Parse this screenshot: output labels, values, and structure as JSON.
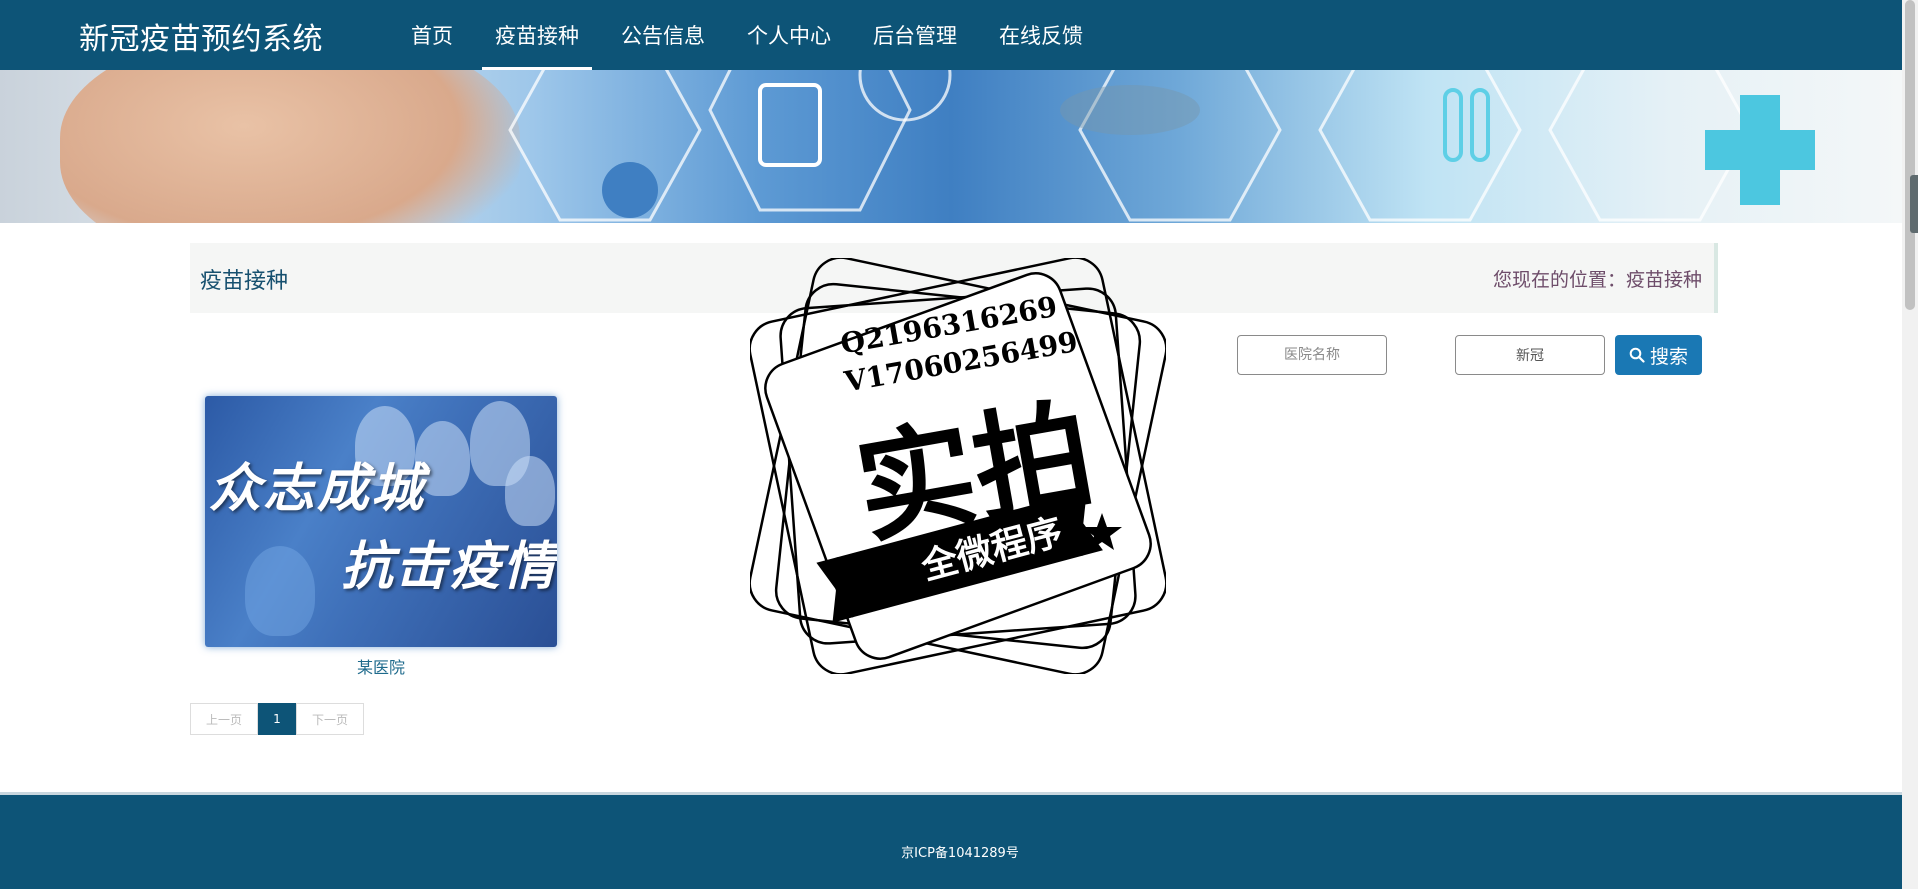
{
  "header": {
    "brand": "新冠疫苗预约系统",
    "nav": [
      {
        "label": "首页",
        "active": false
      },
      {
        "label": "疫苗接种",
        "active": true
      },
      {
        "label": "公告信息",
        "active": false
      },
      {
        "label": "个人中心",
        "active": false
      },
      {
        "label": "后台管理",
        "active": false
      },
      {
        "label": "在线反馈",
        "active": false
      }
    ]
  },
  "banner": {
    "slides": 4,
    "active_slide": 1
  },
  "section": {
    "title": "疫苗接种",
    "location": "您现在的位置：疫苗接种"
  },
  "search": {
    "hospital_placeholder": "医院名称",
    "keyword_value": "新冠",
    "button_label": "搜索"
  },
  "cards": [
    {
      "caption": "某医院",
      "image_text_1": "众志成城",
      "image_text_2": "抗击疫情"
    }
  ],
  "pagination": {
    "prev": "上一页",
    "current": "1",
    "next": "下一页"
  },
  "watermark": {
    "line1": "Q2196316269",
    "line2": "V17060256499",
    "main": "实拍",
    "banner": "全微程序"
  },
  "footer": {
    "icp": "京ICP备1041289号"
  },
  "colors": {
    "primary": "#0d5477",
    "button": "#1a78b4",
    "title": "#16506f"
  }
}
